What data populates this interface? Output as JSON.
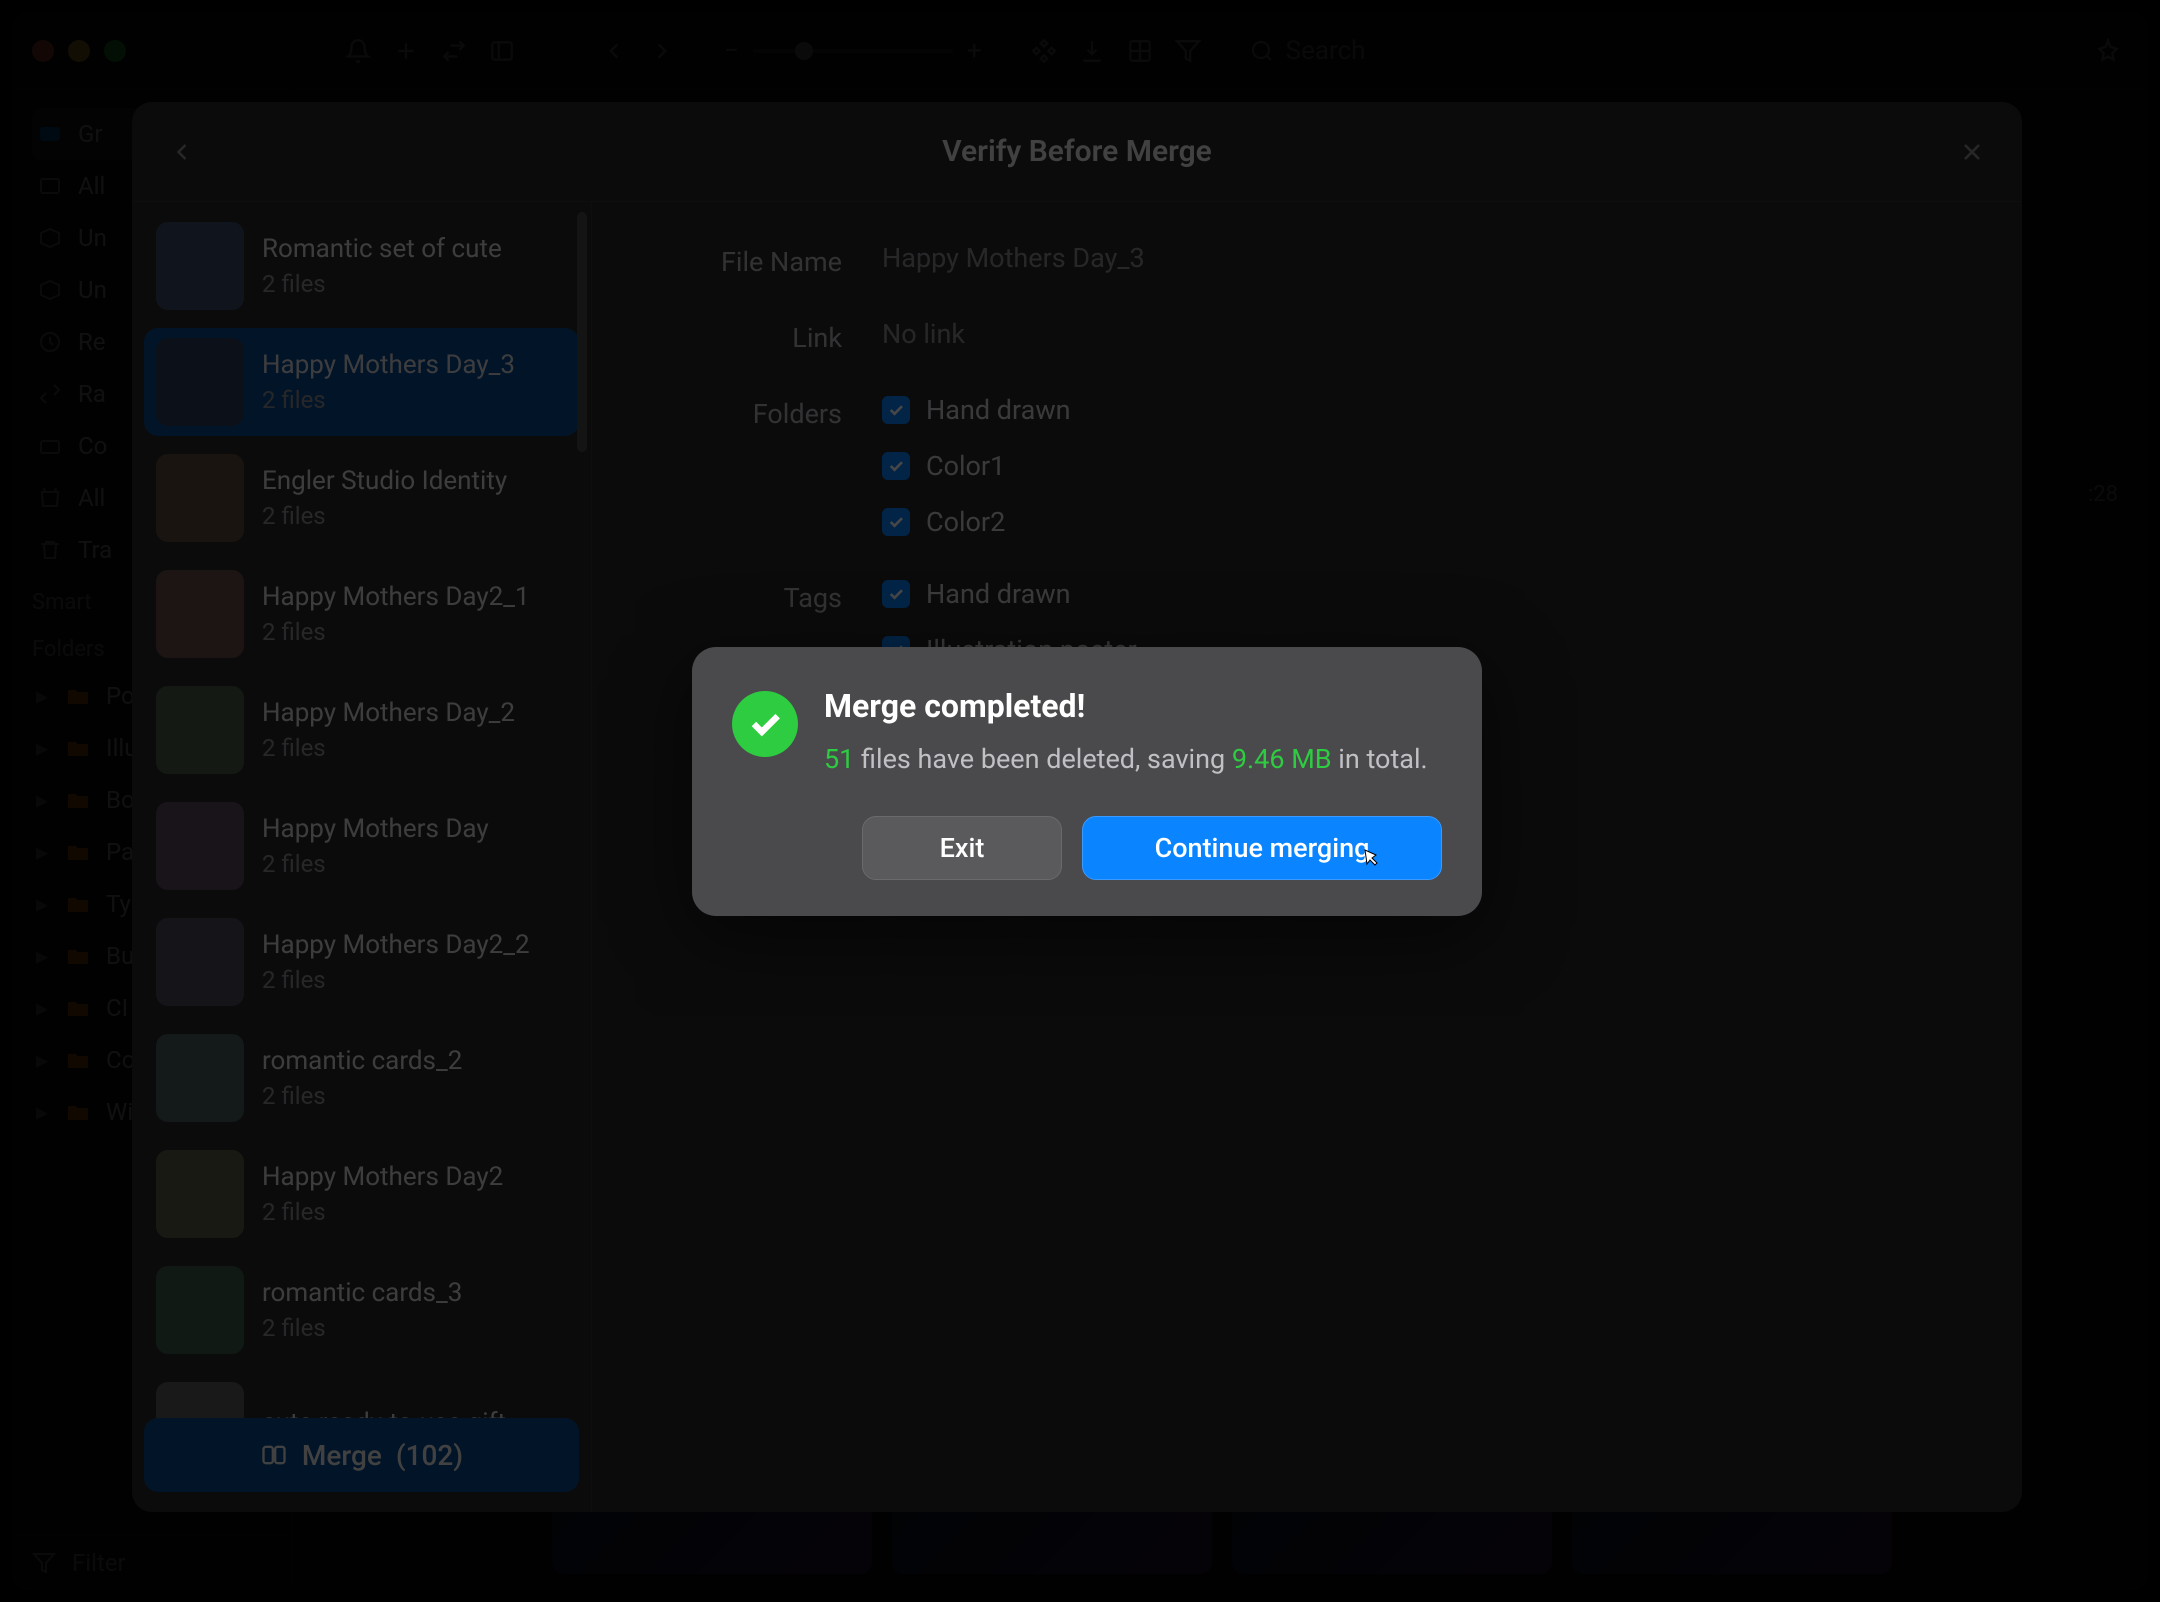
{
  "titlebar": {
    "search_placeholder": "Search"
  },
  "sidebar": {
    "topPartial": "Gr",
    "items": [
      "All",
      "Un",
      "Un",
      "Re",
      "Ra",
      "Co",
      "All",
      "Tra"
    ],
    "smart_label": "Smart",
    "folders_label": "Folders",
    "folders": [
      "Po",
      "Illu",
      "Bo",
      "Pa",
      "Ty",
      "Bu",
      "CI",
      "Co",
      "Wi"
    ],
    "filter_label": "Filter"
  },
  "modal": {
    "title": "Verify Before Merge",
    "merge_button": "Merge",
    "merge_count": "(102)",
    "files": [
      {
        "name": "Romantic set of cute",
        "count": "2 files"
      },
      {
        "name": "Happy Mothers Day_3",
        "count": "2 files",
        "selected": true
      },
      {
        "name": "Engler Studio Identity",
        "count": "2 files"
      },
      {
        "name": "Happy Mothers Day2_1",
        "count": "2 files"
      },
      {
        "name": "Happy Mothers Day_2",
        "count": "2 files"
      },
      {
        "name": "Happy Mothers Day",
        "count": "2 files"
      },
      {
        "name": "Happy Mothers Day2_2",
        "count": "2 files"
      },
      {
        "name": "romantic cards_2",
        "count": "2 files"
      },
      {
        "name": "Happy Mothers Day2",
        "count": "2 files"
      },
      {
        "name": "romantic cards_3",
        "count": "2 files"
      },
      {
        "name": "cute ready-to-use gift",
        "count": ""
      }
    ],
    "detail": {
      "labels": {
        "filename": "File Name",
        "link": "Link",
        "folders": "Folders",
        "tags": "Tags"
      },
      "filename": "Happy Mothers Day_3",
      "link": "No link",
      "folders": [
        "Hand drawn",
        "Color1",
        "Color2"
      ],
      "tags": [
        "Hand drawn",
        "Illustration poster"
      ]
    }
  },
  "dialog": {
    "title": "Merge completed!",
    "deleted_count": "51",
    "msg_mid": " files have been deleted, saving ",
    "saved_size": "9.46 MB",
    "msg_end": " in total.",
    "exit": "Exit",
    "continue": "Continue merging"
  },
  "misc": {
    "timestamp_partial": ":28"
  }
}
